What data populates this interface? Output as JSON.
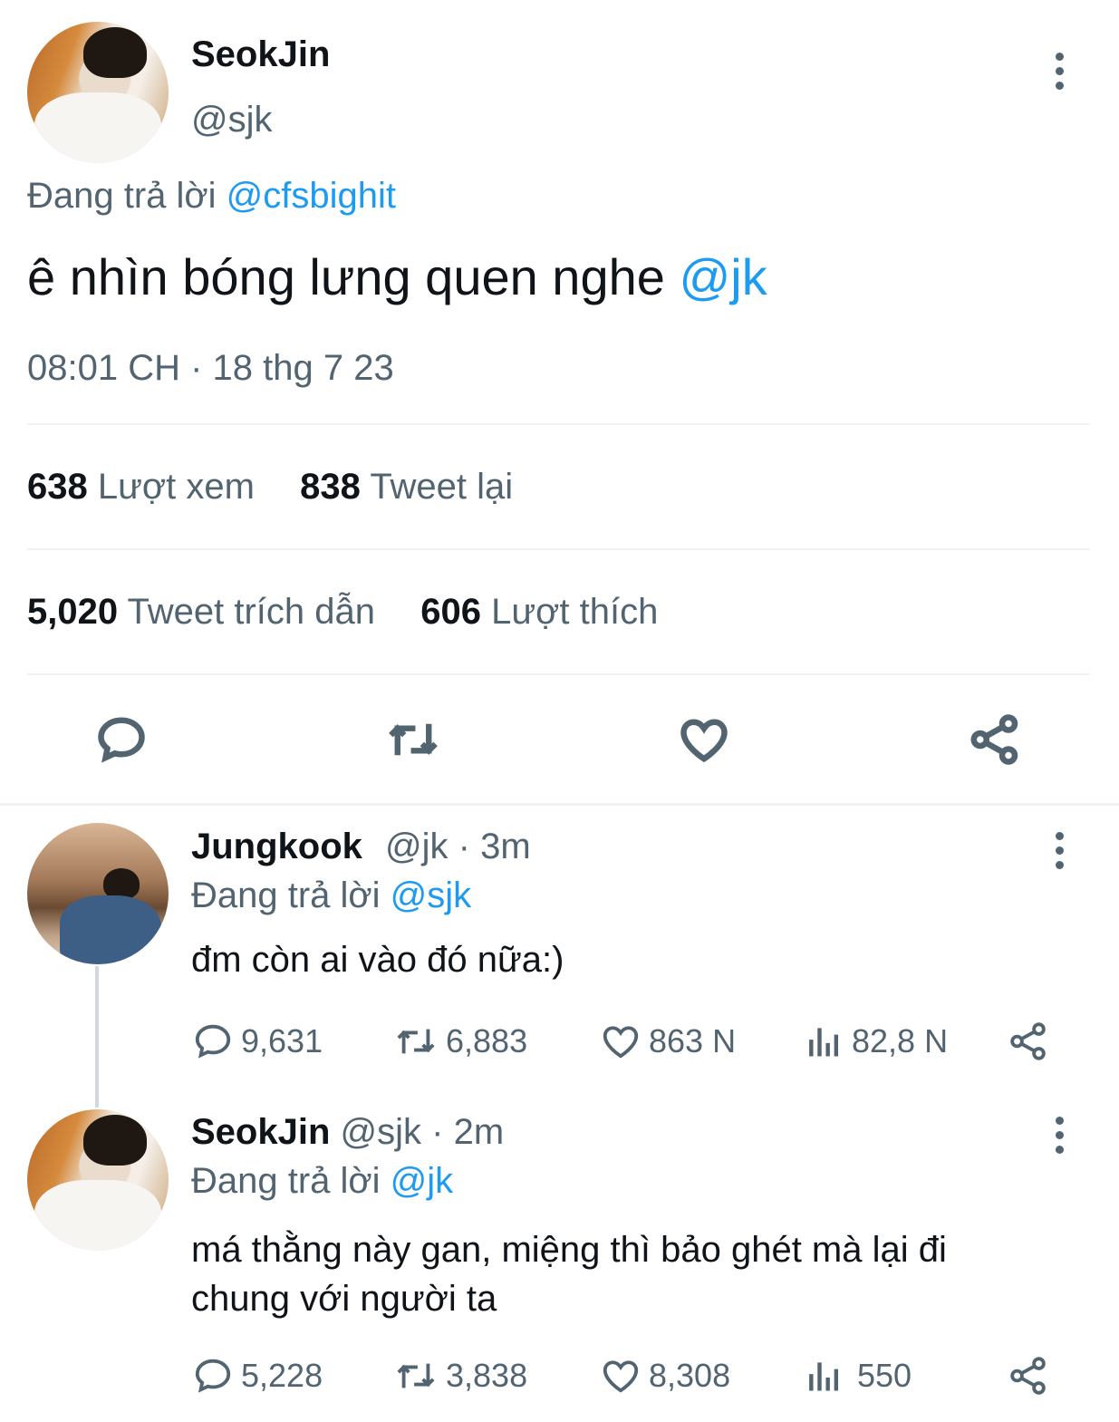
{
  "main_tweet": {
    "name": "SeokJin",
    "handle": "@sjk",
    "replying_prefix": "Đang trả lời",
    "replying_to": "@cfsbighit",
    "text": "ê nhìn bóng lưng quen nghe",
    "mention": "@jk",
    "timestamp": "08:01 CH · 18 thg 7 23",
    "stats": {
      "views_count": "638",
      "views_label": "Lượt xem",
      "retweets_count": "838",
      "retweets_label": "Tweet lại",
      "quotes_count": "5,020",
      "quotes_label": "Tweet trích dẫn",
      "likes_count": "606",
      "likes_label": "Lượt thích"
    },
    "actions": [
      "reply-icon",
      "retweet-icon",
      "like-icon",
      "share-icon"
    ]
  },
  "replies": [
    {
      "name": "Jungkook",
      "handle": "@jk",
      "time": "· 3m",
      "replying_prefix": "Đang trả lời",
      "replying_to": "@sjk",
      "text": "đm còn ai vào đó nữa:)",
      "replies": "9,631",
      "retweets": "6,883",
      "likes": "863 N",
      "views": "82,8 N"
    },
    {
      "name": "SeokJin",
      "handle": "@sjk",
      "time": "· 2m",
      "replying_prefix": "Đang trả lời",
      "replying_to": "@jk",
      "text_line1": "má thằng này gan, miệng thì bảo ghét mà lại đi",
      "text_line2": "chung với người ta",
      "replies": "5,228",
      "retweets": "3,838",
      "likes": "8,308",
      "views": "550"
    }
  ],
  "colors": {
    "link": "#1d9bf0",
    "muted": "#536471",
    "text": "#0f1419",
    "divider": "#eff3f4"
  }
}
